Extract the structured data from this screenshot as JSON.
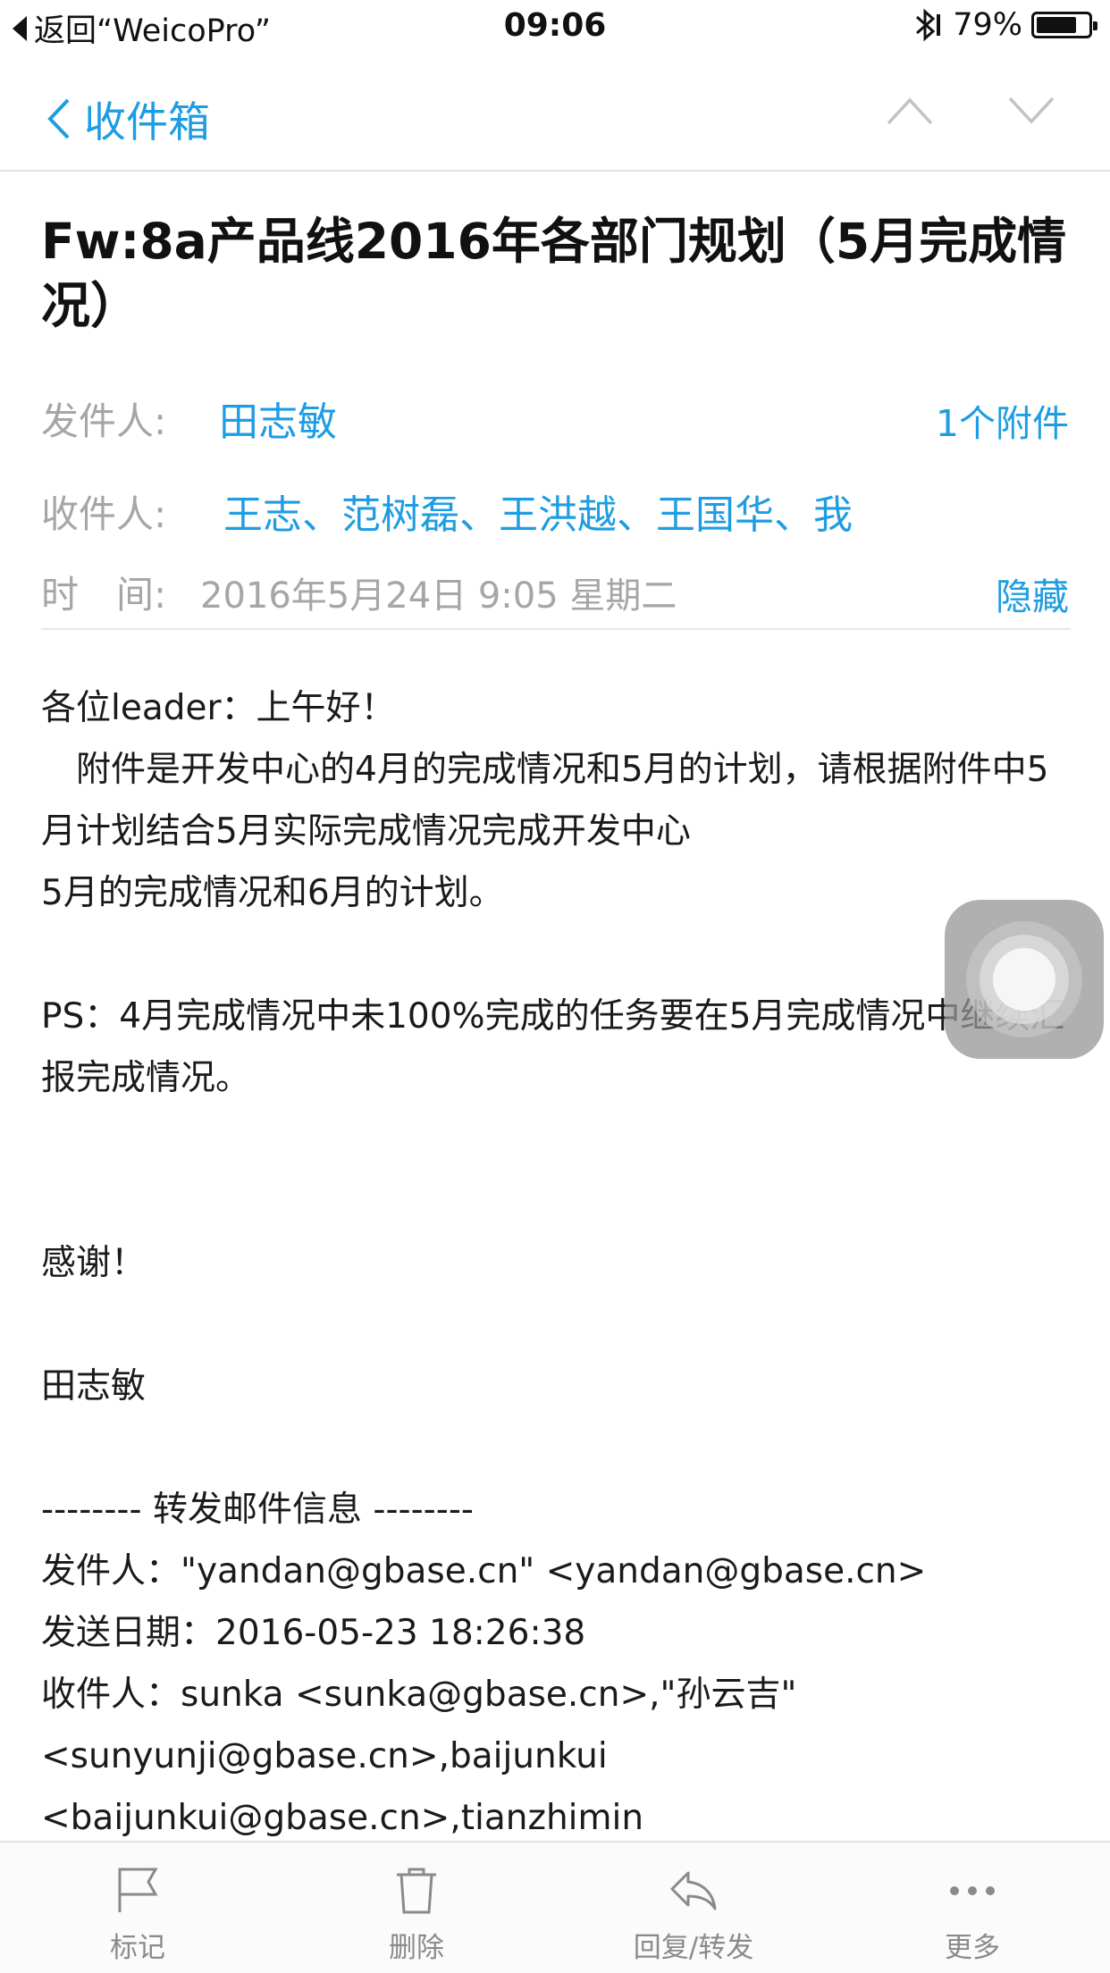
{
  "status_bar": {
    "back_app": "返回“WeicoPro”",
    "time": "09:06",
    "battery": "79%",
    "battery_level": 0.79
  },
  "nav": {
    "back_label": "收件箱"
  },
  "email": {
    "subject": "Fw:8a产品线2016年各部门规划（5月完成情况）",
    "sender_label": "发件人:",
    "sender": "田志敏",
    "attachments": "1个附件",
    "recipients_label": "收件人:",
    "recipients": "王志、范树磊、王洪越、王国华、我",
    "time_label": "时　间:",
    "time": "2016年5月24日 9:05 星期二",
    "hide_label": "隐藏"
  },
  "body": {
    "greeting": "各位leader：上午好！",
    "para1": "　附件是开发中心的4月的完成情况和5月的计划，请根据附件中5月计划结合5月实际完成情况完成开发中心",
    "para1b": "5月的完成情况和6月的计划。",
    "ps": "PS：4月完成情况中未100%完成的任务要在5月完成情况中继续汇报完成情况。",
    "thanks": "感谢！",
    "signature": "田志敏",
    "fwd_header": "-------- 转发邮件信息 --------",
    "fwd_from": "发件人：\"yandan@gbase.cn\" <yandan@gbase.cn>",
    "fwd_date": "发送日期：2016-05-23 18:26:38",
    "fwd_to_1": "收件人：sunka <sunka@gbase.cn>,\"孙云吉\"",
    "fwd_to_2": "<sunyunji@gbase.cn>,baijunkui",
    "fwd_to_3": "<baijunkui@gbase.cn>,tianzhimin"
  },
  "toolbar": {
    "flag": "标记",
    "delete": "删除",
    "reply": "回复/转发",
    "more": "更多"
  },
  "colors": {
    "accent": "#1e9de2",
    "muted": "#a6a6a6"
  }
}
